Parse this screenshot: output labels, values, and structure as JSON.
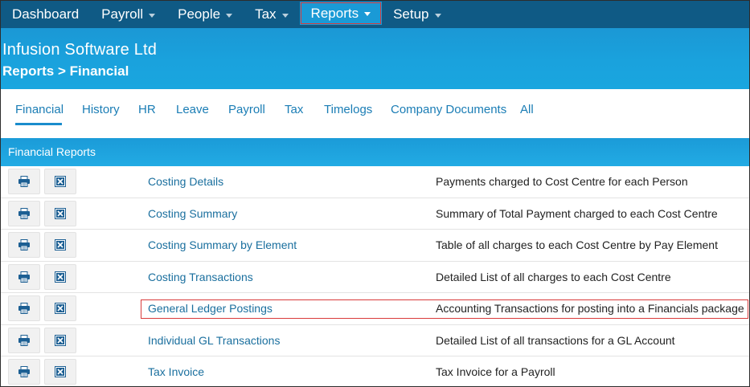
{
  "nav": {
    "items": [
      {
        "label": "Dashboard",
        "has_caret": false
      },
      {
        "label": "Payroll",
        "has_caret": true
      },
      {
        "label": "People",
        "has_caret": true
      },
      {
        "label": "Tax",
        "has_caret": true
      },
      {
        "label": "Reports",
        "has_caret": true,
        "active": true
      },
      {
        "label": "Setup",
        "has_caret": true
      }
    ]
  },
  "header": {
    "company": "Infusion Software Ltd",
    "breadcrumb": "Reports > Financial"
  },
  "tabs": [
    {
      "label": "Financial",
      "active": true
    },
    {
      "label": "History"
    },
    {
      "label": "HR"
    },
    {
      "label": "Leave"
    },
    {
      "label": "Payroll"
    },
    {
      "label": "Tax"
    },
    {
      "label": "Timelogs"
    },
    {
      "label": "Company Documents"
    },
    {
      "label": "All"
    }
  ],
  "section": {
    "title": "Financial Reports"
  },
  "reports": [
    {
      "name": "Costing Details",
      "description": "Payments charged to Cost Centre for each Person"
    },
    {
      "name": "Costing Summary",
      "description": "Summary of Total Payment charged to each Cost Centre"
    },
    {
      "name": "Costing Summary by Element",
      "description": "Table of all charges to each Cost Centre by Pay Element"
    },
    {
      "name": "Costing Transactions",
      "description": "Detailed List of all charges to each Cost Centre"
    },
    {
      "name": "General Ledger Postings",
      "description": "Accounting Transactions for posting into a Financials package",
      "highlighted": true
    },
    {
      "name": "Individual GL Transactions",
      "description": "Detailed List of all transactions for a GL Account"
    },
    {
      "name": "Tax Invoice",
      "description": "Tax Invoice for a Payroll"
    }
  ],
  "icons": {
    "print": "printer-icon",
    "excel": "excel-icon"
  },
  "colors": {
    "nav_bg": "#0f5a85",
    "accent": "#1a9ad6",
    "link": "#1a6f9e",
    "highlight": "#d93a3a"
  }
}
